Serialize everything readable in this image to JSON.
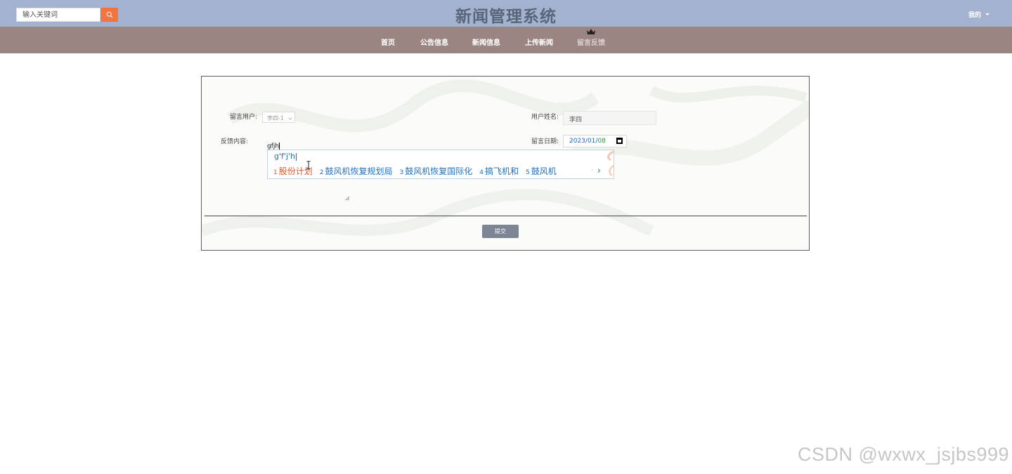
{
  "header": {
    "search_placeholder": "输入关键词",
    "title": "新闻管理系统",
    "user_menu": "我的"
  },
  "nav": {
    "items": [
      {
        "label": "首页"
      },
      {
        "label": "公告信息"
      },
      {
        "label": "新闻信息"
      },
      {
        "label": "上传新闻"
      },
      {
        "label": "留言反馈"
      }
    ],
    "active_index": 4
  },
  "form": {
    "user_label": "留言用户:",
    "user_value": "李四-1",
    "name_label": "用户姓名:",
    "name_value": "李四",
    "content_label": "反馈内容:",
    "content_value": "gfjh",
    "date_label": "留言日期:",
    "date_year": "2023/",
    "date_month": "01",
    "date_sep": "/",
    "date_day": "08",
    "submit_label": "提交"
  },
  "ime": {
    "composition": "g'f'j'h",
    "candidates": [
      {
        "num": "1",
        "text": "股份计划"
      },
      {
        "num": "2",
        "text": "鼓风机恢复规划局"
      },
      {
        "num": "3",
        "text": "鼓风机恢复国际化"
      },
      {
        "num": "4",
        "text": "搞飞机和"
      },
      {
        "num": "5",
        "text": "鼓风机"
      }
    ],
    "next": "›"
  },
  "watermark": "CSDN @wxwx_jsjbs999",
  "colors": {
    "topbar": "#a3b3cf",
    "navbar": "#9a8582",
    "search_button": "#f27443",
    "submit_button": "#7d8594"
  }
}
